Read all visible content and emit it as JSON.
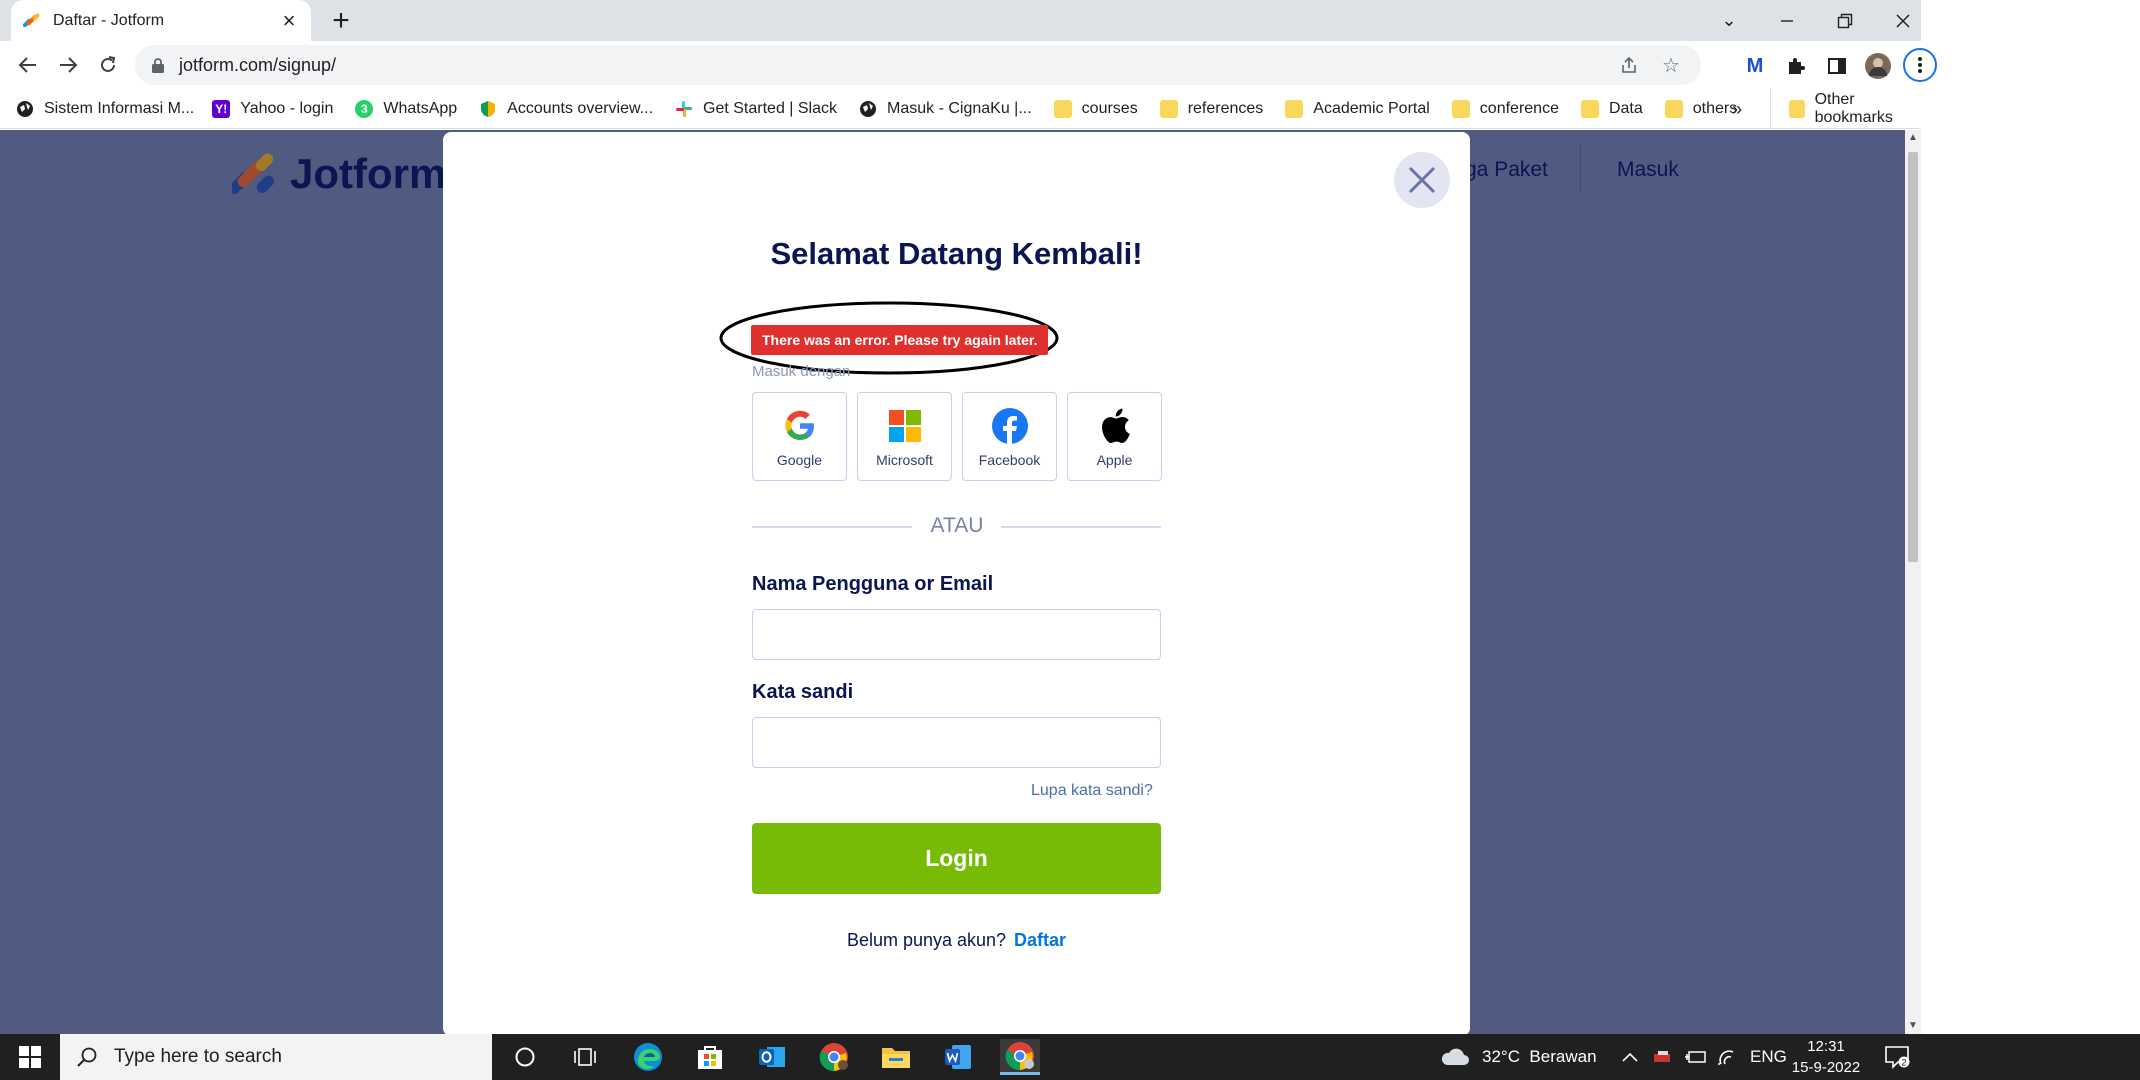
{
  "browser": {
    "tab_title": "Daftar - Jotform",
    "url": "jotform.com/signup/",
    "bookmarks": [
      {
        "label": "Sistem Informasi M...",
        "icon": "globe-icon",
        "color": "#202124"
      },
      {
        "label": "Yahoo - login",
        "icon": "yahoo-icon",
        "color": "#6001d2"
      },
      {
        "label": "WhatsApp",
        "icon": "whatsapp-icon",
        "color": "#25d366"
      },
      {
        "label": "Accounts overview...",
        "icon": "shield-icon",
        "color": "#0f9d58"
      },
      {
        "label": "Get Started | Slack",
        "icon": "slack-icon",
        "color": "#e01e5a"
      },
      {
        "label": "Masuk - CignaKu |...",
        "icon": "globe-icon",
        "color": "#202124"
      },
      {
        "label": "courses",
        "icon": "folder-icon",
        "color": "#f9d65c"
      },
      {
        "label": "references",
        "icon": "folder-icon",
        "color": "#f9d65c"
      },
      {
        "label": "Academic Portal",
        "icon": "folder-icon",
        "color": "#f9d65c"
      },
      {
        "label": "conference",
        "icon": "folder-icon",
        "color": "#f9d65c"
      },
      {
        "label": "Data",
        "icon": "folder-icon",
        "color": "#f9d65c"
      },
      {
        "label": "others",
        "icon": "folder-icon",
        "color": "#f9d65c"
      }
    ],
    "more_bookmarks": "»",
    "other_bookmarks": "Other bookmarks"
  },
  "site": {
    "logo_text": "Jotform",
    "nav": {
      "pricing_partial": "ga Paket",
      "login": "Masuk"
    }
  },
  "modal": {
    "title": "Selamat Datang Kembali!",
    "error": "There was an error. Please try again later.",
    "login_with": "Masuk dengan",
    "social": [
      {
        "label": "Google",
        "icon": "google-icon"
      },
      {
        "label": "Microsoft",
        "icon": "microsoft-icon"
      },
      {
        "label": "Facebook",
        "icon": "facebook-icon"
      },
      {
        "label": "Apple",
        "icon": "apple-icon"
      }
    ],
    "divider": "ATAU",
    "username_label": "Nama Pengguna or Email",
    "username_value": "",
    "password_label": "Kata sandi",
    "password_value": "",
    "forgot": "Lupa kata sandi?",
    "login_button": "Login",
    "no_account": "Belum punya akun?",
    "signup_link": "Daftar"
  },
  "taskbar": {
    "search_placeholder": "Type here to search",
    "weather": "32°C  Berawan",
    "language": "ENG",
    "time": "12:31",
    "date": "15-9-2022",
    "notifications": "2"
  },
  "colors": {
    "overlay": "#515a80",
    "brand_navy": "#0a1551",
    "error_red": "#e0302e",
    "login_green": "#78bb07",
    "link_blue": "#0075e3"
  }
}
